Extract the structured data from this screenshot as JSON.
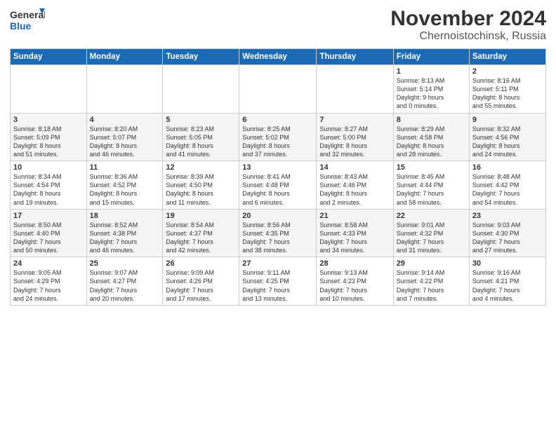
{
  "logo": {
    "line1": "General",
    "line2": "Blue"
  },
  "title": "November 2024",
  "subtitle": "Chernoistochinsk, Russia",
  "days_of_week": [
    "Sunday",
    "Monday",
    "Tuesday",
    "Wednesday",
    "Thursday",
    "Friday",
    "Saturday"
  ],
  "weeks": [
    [
      {
        "day": "",
        "info": ""
      },
      {
        "day": "",
        "info": ""
      },
      {
        "day": "",
        "info": ""
      },
      {
        "day": "",
        "info": ""
      },
      {
        "day": "",
        "info": ""
      },
      {
        "day": "1",
        "info": "Sunrise: 8:13 AM\nSunset: 5:14 PM\nDaylight: 9 hours\nand 0 minutes."
      },
      {
        "day": "2",
        "info": "Sunrise: 8:16 AM\nSunset: 5:11 PM\nDaylight: 8 hours\nand 55 minutes."
      }
    ],
    [
      {
        "day": "3",
        "info": "Sunrise: 8:18 AM\nSunset: 5:09 PM\nDaylight: 8 hours\nand 51 minutes."
      },
      {
        "day": "4",
        "info": "Sunrise: 8:20 AM\nSunset: 5:07 PM\nDaylight: 8 hours\nand 46 minutes."
      },
      {
        "day": "5",
        "info": "Sunrise: 8:23 AM\nSunset: 5:05 PM\nDaylight: 8 hours\nand 41 minutes."
      },
      {
        "day": "6",
        "info": "Sunrise: 8:25 AM\nSunset: 5:02 PM\nDaylight: 8 hours\nand 37 minutes."
      },
      {
        "day": "7",
        "info": "Sunrise: 8:27 AM\nSunset: 5:00 PM\nDaylight: 8 hours\nand 32 minutes."
      },
      {
        "day": "8",
        "info": "Sunrise: 8:29 AM\nSunset: 4:58 PM\nDaylight: 8 hours\nand 28 minutes."
      },
      {
        "day": "9",
        "info": "Sunrise: 8:32 AM\nSunset: 4:56 PM\nDaylight: 8 hours\nand 24 minutes."
      }
    ],
    [
      {
        "day": "10",
        "info": "Sunrise: 8:34 AM\nSunset: 4:54 PM\nDaylight: 8 hours\nand 19 minutes."
      },
      {
        "day": "11",
        "info": "Sunrise: 8:36 AM\nSunset: 4:52 PM\nDaylight: 8 hours\nand 15 minutes."
      },
      {
        "day": "12",
        "info": "Sunrise: 8:39 AM\nSunset: 4:50 PM\nDaylight: 8 hours\nand 11 minutes."
      },
      {
        "day": "13",
        "info": "Sunrise: 8:41 AM\nSunset: 4:48 PM\nDaylight: 8 hours\nand 6 minutes."
      },
      {
        "day": "14",
        "info": "Sunrise: 8:43 AM\nSunset: 4:46 PM\nDaylight: 8 hours\nand 2 minutes."
      },
      {
        "day": "15",
        "info": "Sunrise: 8:45 AM\nSunset: 4:44 PM\nDaylight: 7 hours\nand 58 minutes."
      },
      {
        "day": "16",
        "info": "Sunrise: 8:48 AM\nSunset: 4:42 PM\nDaylight: 7 hours\nand 54 minutes."
      }
    ],
    [
      {
        "day": "17",
        "info": "Sunrise: 8:50 AM\nSunset: 4:40 PM\nDaylight: 7 hours\nand 50 minutes."
      },
      {
        "day": "18",
        "info": "Sunrise: 8:52 AM\nSunset: 4:38 PM\nDaylight: 7 hours\nand 46 minutes."
      },
      {
        "day": "19",
        "info": "Sunrise: 8:54 AM\nSunset: 4:37 PM\nDaylight: 7 hours\nand 42 minutes."
      },
      {
        "day": "20",
        "info": "Sunrise: 8:56 AM\nSunset: 4:35 PM\nDaylight: 7 hours\nand 38 minutes."
      },
      {
        "day": "21",
        "info": "Sunrise: 8:58 AM\nSunset: 4:33 PM\nDaylight: 7 hours\nand 34 minutes."
      },
      {
        "day": "22",
        "info": "Sunrise: 9:01 AM\nSunset: 4:32 PM\nDaylight: 7 hours\nand 31 minutes."
      },
      {
        "day": "23",
        "info": "Sunrise: 9:03 AM\nSunset: 4:30 PM\nDaylight: 7 hours\nand 27 minutes."
      }
    ],
    [
      {
        "day": "24",
        "info": "Sunrise: 9:05 AM\nSunset: 4:29 PM\nDaylight: 7 hours\nand 24 minutes."
      },
      {
        "day": "25",
        "info": "Sunrise: 9:07 AM\nSunset: 4:27 PM\nDaylight: 7 hours\nand 20 minutes."
      },
      {
        "day": "26",
        "info": "Sunrise: 9:09 AM\nSunset: 4:26 PM\nDaylight: 7 hours\nand 17 minutes."
      },
      {
        "day": "27",
        "info": "Sunrise: 9:11 AM\nSunset: 4:25 PM\nDaylight: 7 hours\nand 13 minutes."
      },
      {
        "day": "28",
        "info": "Sunrise: 9:13 AM\nSunset: 4:23 PM\nDaylight: 7 hours\nand 10 minutes."
      },
      {
        "day": "29",
        "info": "Sunrise: 9:14 AM\nSunset: 4:22 PM\nDaylight: 7 hours\nand 7 minutes."
      },
      {
        "day": "30",
        "info": "Sunrise: 9:16 AM\nSunset: 4:21 PM\nDaylight: 7 hours\nand 4 minutes."
      }
    ]
  ]
}
